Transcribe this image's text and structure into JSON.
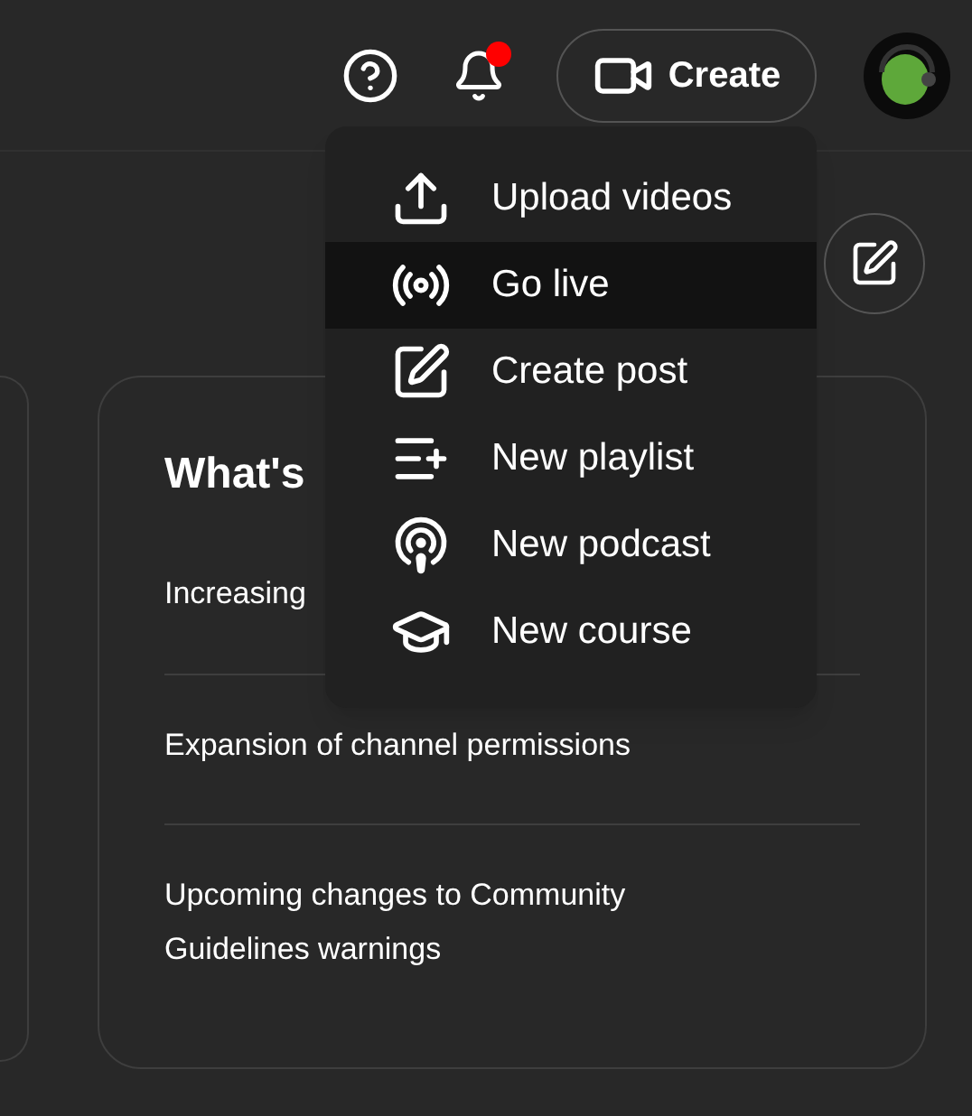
{
  "header": {
    "create_button": "Create",
    "notifications": {
      "unread": true
    }
  },
  "create_menu": {
    "items": [
      {
        "label": "Upload videos",
        "selected": false
      },
      {
        "label": "Go live",
        "selected": true
      },
      {
        "label": "Create post",
        "selected": false
      },
      {
        "label": "New playlist",
        "selected": false
      },
      {
        "label": "New podcast",
        "selected": false
      },
      {
        "label": "New course",
        "selected": false
      }
    ]
  },
  "whats_new": {
    "title": "What's",
    "items": [
      "Increasing",
      "Expansion of channel permissions",
      "Upcoming changes to Community Guidelines warnings"
    ]
  }
}
